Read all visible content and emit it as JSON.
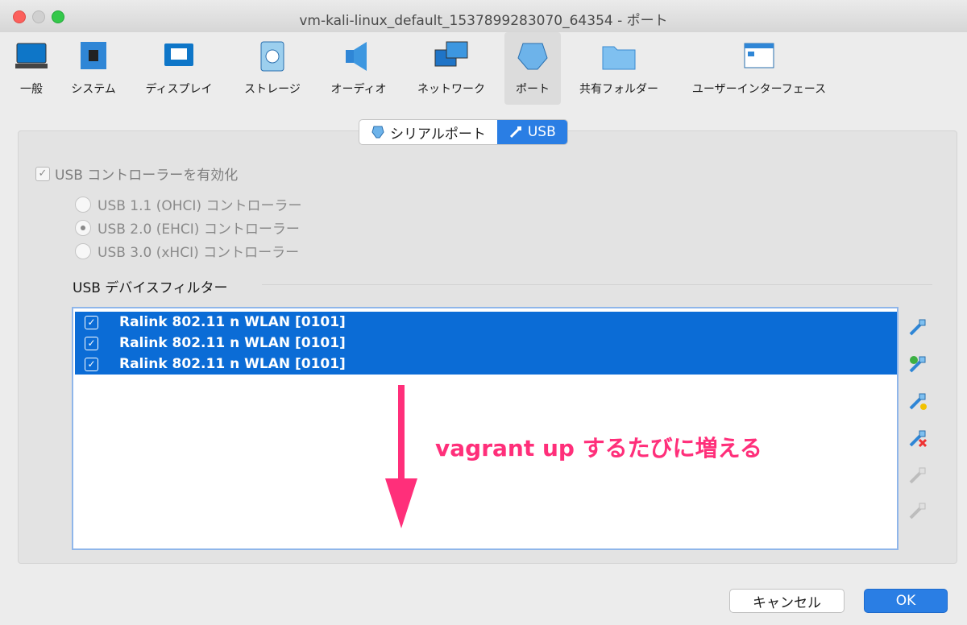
{
  "window": {
    "title": "vm-kali-linux_default_1537899283070_64354 - ポート"
  },
  "toolbar": {
    "items": [
      {
        "label": "一般",
        "icon": "monitor-icon"
      },
      {
        "label": "システム",
        "icon": "chip-icon"
      },
      {
        "label": "ディスプレイ",
        "icon": "display-icon"
      },
      {
        "label": "ストレージ",
        "icon": "disk-icon"
      },
      {
        "label": "オーディオ",
        "icon": "speaker-icon"
      },
      {
        "label": "ネットワーク",
        "icon": "network-icon"
      },
      {
        "label": "ポート",
        "icon": "port-icon"
      },
      {
        "label": "共有フォルダー",
        "icon": "folder-icon"
      },
      {
        "label": "ユーザーインターフェース",
        "icon": "window-icon"
      }
    ],
    "selected": "ポート"
  },
  "tabs": {
    "serial": "シリアルポート",
    "usb": "USB",
    "active": "USB"
  },
  "usb": {
    "enable_label": "USB コントローラーを有効化",
    "radios": [
      "USB 1.1 (OHCI) コントローラー",
      "USB 2.0 (EHCI) コントローラー",
      "USB 3.0 (xHCI) コントローラー"
    ],
    "selected_radio": "USB 2.0 (EHCI) コントローラー",
    "filter_title": "USB デバイスフィルター",
    "filters": [
      "Ralink 802.11 n WLAN [0101]",
      "Ralink 802.11 n WLAN [0101]",
      "Ralink 802.11 n WLAN [0101]"
    ]
  },
  "annotation": {
    "text": "vagrant up するたびに増える",
    "color": "#ff2f7a"
  },
  "buttons": {
    "cancel": "キャンセル",
    "ok": "OK"
  },
  "colors": {
    "accent": "#2a7ee4",
    "selection": "#0b6cd6"
  }
}
